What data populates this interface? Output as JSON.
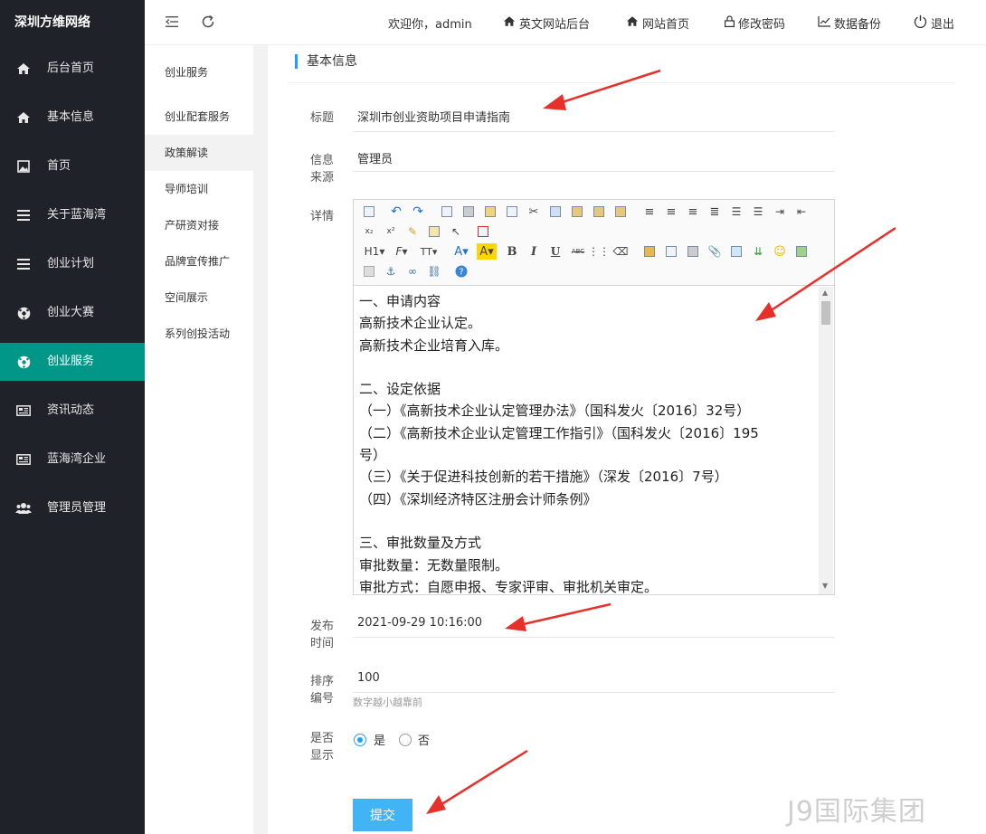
{
  "brand": "深圳方维网络",
  "sidebar": {
    "items": [
      {
        "label": "后台首页",
        "icon": "home-icon"
      },
      {
        "label": "基本信息",
        "icon": "home-icon"
      },
      {
        "label": "首页",
        "icon": "image-icon"
      },
      {
        "label": "关于蓝海湾",
        "icon": "list-icon"
      },
      {
        "label": "创业计划",
        "icon": "list-icon"
      },
      {
        "label": "创业大赛",
        "icon": "soccer-icon"
      },
      {
        "label": "创业服务",
        "icon": "soccer-icon",
        "active": true
      },
      {
        "label": "资讯动态",
        "icon": "news-icon"
      },
      {
        "label": "蓝海湾企业",
        "icon": "news-icon"
      },
      {
        "label": "管理员管理",
        "icon": "users-icon"
      }
    ]
  },
  "topbar": {
    "welcome": "欢迎你，admin",
    "links": [
      {
        "label": "英文网站后台",
        "icon": "home-icon"
      },
      {
        "label": "网站首页",
        "icon": "home-icon"
      },
      {
        "label": "修改密码",
        "icon": "lock-icon"
      },
      {
        "label": "数据备份",
        "icon": "chart-icon"
      },
      {
        "label": "退出",
        "icon": "power-icon"
      }
    ]
  },
  "submenu": {
    "items": [
      {
        "label": "创业服务"
      },
      {
        "label": "创业配套服务"
      },
      {
        "label": "政策解读",
        "active": true
      },
      {
        "label": "导师培训"
      },
      {
        "label": "产研资对接"
      },
      {
        "label": "品牌宣传推广"
      },
      {
        "label": "空间展示"
      },
      {
        "label": "系列创投活动"
      }
    ]
  },
  "form": {
    "section_title": "基本信息",
    "title_label": "标题",
    "title_value": "深圳市创业资助项目申请指南",
    "source_label": "信息来源",
    "source_value": "管理员",
    "detail_label": "详情",
    "toolbar_text": {
      "h1": "H1",
      "font": "F",
      "size": "TT",
      "fontcolor": "A",
      "bgcolor": "A",
      "bold": "B",
      "italic": "I",
      "underline": "U",
      "strike": "ABC"
    },
    "editor_lines": [
      "一、申请内容",
      "高新技术企业认定。",
      "高新技术企业培育入库。",
      "",
      "二、设定依据",
      "（一）《高新技术企业认定管理办法》（国科发火〔2016〕32号）",
      "（二）《高新技术企业认定管理工作指引》（国科发火〔2016〕195",
      "号）",
      "（三）《关于促进科技创新的若干措施》（深发〔2016〕7号）",
      "（四）《深圳经济特区注册会计师条例》",
      "",
      "三、审批数量及方式",
      "审批数量：无数量限制。",
      "审批方式：自愿申报、专家评审、审批机关审定。"
    ],
    "publish_label": "发布时间",
    "publish_value": "2021-09-29 10:16:00",
    "sort_label": "排序编号",
    "sort_value": "100",
    "sort_hint": "数字越小越靠前",
    "display_label": "是否显示",
    "display_yes": "是",
    "display_no": "否",
    "display_selected": "是",
    "submit_label": "提交"
  },
  "watermark": "J9国际集团",
  "colors": {
    "sidebar_bg": "#20222a",
    "active": "#009688",
    "accent": "#1e9fff",
    "button": "#41b4f5",
    "arrow": "#e8302a"
  }
}
